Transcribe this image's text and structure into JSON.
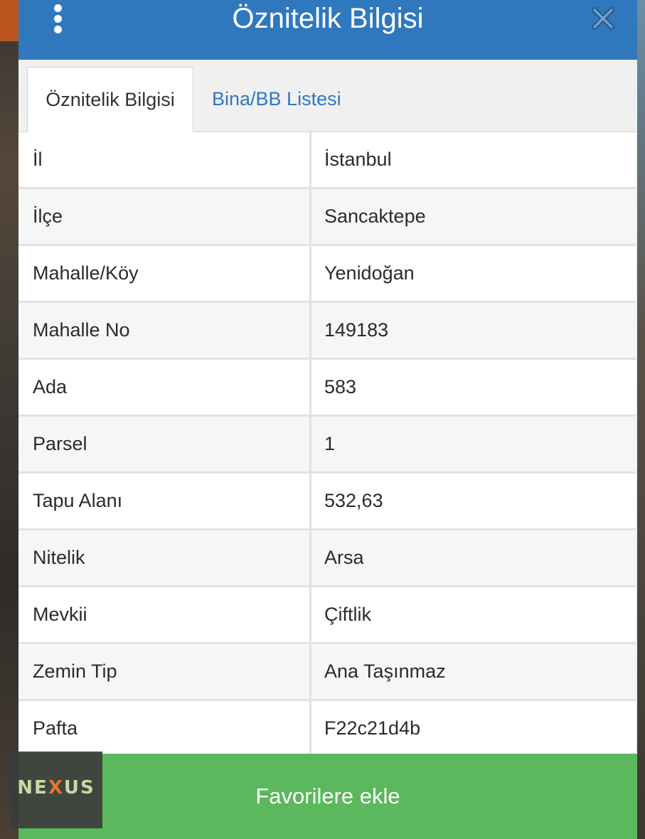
{
  "dialog": {
    "title": "Öznitelik Bilgisi",
    "menu_icon": "vertical-ellipsis-icon",
    "close_icon": "close-icon"
  },
  "tabs": [
    {
      "label": "Öznitelik Bilgisi",
      "active": true
    },
    {
      "label": "Bina/BB Listesi",
      "active": false
    }
  ],
  "attributes": [
    {
      "label": "İl",
      "value": "İstanbul"
    },
    {
      "label": "İlçe",
      "value": "Sancaktepe"
    },
    {
      "label": "Mahalle/Köy",
      "value": "Yenidoğan"
    },
    {
      "label": "Mahalle No",
      "value": "149183"
    },
    {
      "label": "Ada",
      "value": "583"
    },
    {
      "label": "Parsel",
      "value": "1"
    },
    {
      "label": "Tapu Alanı",
      "value": "532,63"
    },
    {
      "label": "Nitelik",
      "value": "Arsa"
    },
    {
      "label": "Mevkii",
      "value": "Çiftlik"
    },
    {
      "label": "Zemin Tip",
      "value": "Ana Taşınmaz"
    },
    {
      "label": "Pafta",
      "value": "F22c21d4b"
    }
  ],
  "footer": {
    "button_label": "Favorilere ekle"
  },
  "watermark": {
    "logo_text": "NEXUS"
  },
  "colors": {
    "header": "#2f78bd",
    "tab_link": "#2f78bd",
    "favorite_button": "#5cb85c"
  }
}
